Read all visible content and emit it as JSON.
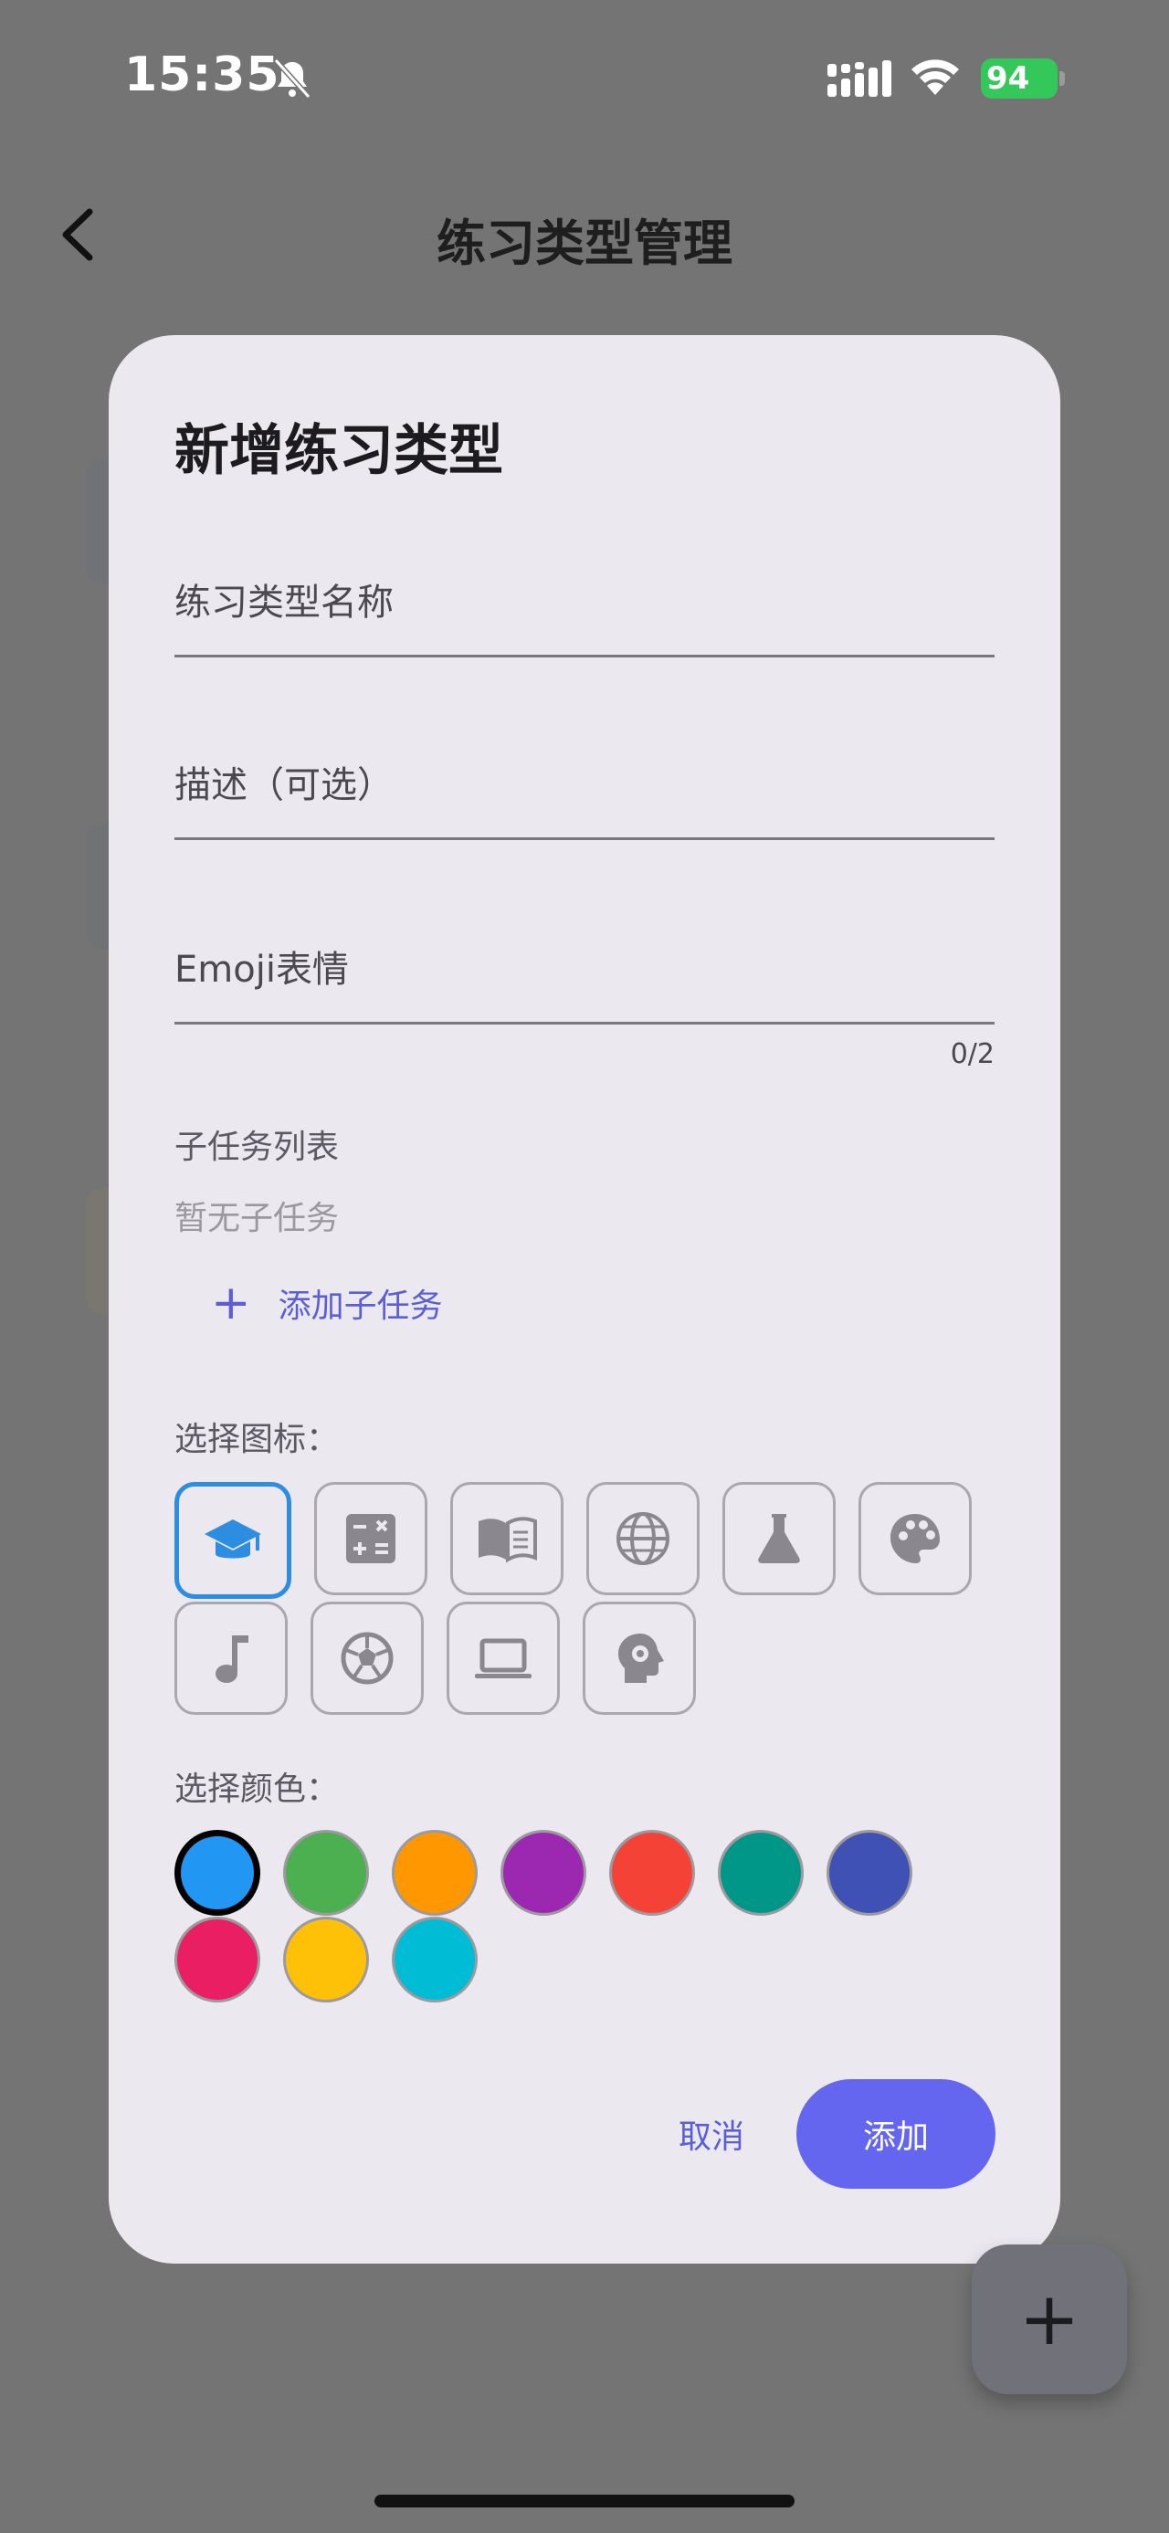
{
  "status_bar": {
    "time": "15:35",
    "battery": "94"
  },
  "header": {
    "title": "练习类型管理"
  },
  "dialog": {
    "title": "新增练习类型",
    "fields": {
      "name_label": "练习类型名称",
      "desc_label": "描述（可选）",
      "emoji_label": "Emoji表情",
      "emoji_counter": "0/2"
    },
    "subtasks": {
      "label": "子任务列表",
      "empty": "暂无子任务",
      "add_label": "添加子任务"
    },
    "icons": {
      "label": "选择图标：",
      "items": [
        "graduation-cap",
        "calculator",
        "book",
        "globe",
        "flask",
        "palette",
        "music-note",
        "soccer-ball",
        "laptop",
        "head-gear"
      ],
      "selected": "graduation-cap"
    },
    "colors": {
      "label": "选择颜色：",
      "items": [
        "#2196F3",
        "#4CAF50",
        "#FF9800",
        "#9C27B0",
        "#F44336",
        "#009688",
        "#3F51B5",
        "#E91E63",
        "#FFC107",
        "#00BCD4"
      ],
      "selected": "#2196F3"
    },
    "actions": {
      "cancel": "取消",
      "add": "添加"
    }
  },
  "fab": {
    "icon": "plus"
  }
}
